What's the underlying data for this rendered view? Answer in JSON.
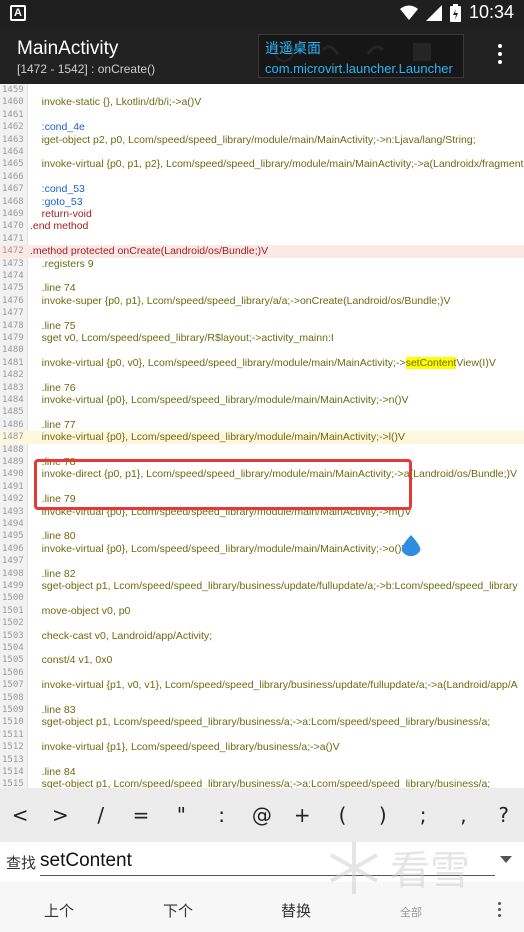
{
  "status": {
    "time": "10:34",
    "left_icon": "A"
  },
  "appbar": {
    "title": "MainActivity",
    "subtitle": "[1472 - 1542] : onCreate()"
  },
  "toast": {
    "title": "逍遥桌面",
    "text": "com.microvirt.launcher.Launcher"
  },
  "code_lines": [
    {
      "n": "1459",
      "t": ""
    },
    {
      "n": "1460",
      "t": "    invoke-static {}, Lkotlin/d/b/i;->a()V"
    },
    {
      "n": "1461",
      "t": ""
    },
    {
      "n": "1462",
      "t": "    :cond_4e",
      "cls": "blue"
    },
    {
      "n": "1463",
      "t": "    iget-object p2, p0, Lcom/speed/speed_library/module/main/MainActivity;->n:Ljava/lang/String;"
    },
    {
      "n": "1464",
      "t": ""
    },
    {
      "n": "1465",
      "t": "    invoke-virtual {p0, p1, p2}, Lcom/speed/speed_library/module/main/MainActivity;->a(Landroidx/fragment"
    },
    {
      "n": "1466",
      "t": ""
    },
    {
      "n": "1467",
      "t": "    :cond_53",
      "cls": "blue"
    },
    {
      "n": "1468",
      "t": "    :goto_53",
      "cls": "blue"
    },
    {
      "n": "1469",
      "t": "    return-void",
      "cls": "kw"
    },
    {
      "n": "1470",
      "t": ".end method",
      "cls": "kw"
    },
    {
      "n": "1471",
      "t": ""
    },
    {
      "n": "1472",
      "t": ".method protected onCreate(Landroid/os/Bundle;)V",
      "cls": "kw",
      "bg": "pink"
    },
    {
      "n": "1473",
      "t": "    .registers 9"
    },
    {
      "n": "1474",
      "t": ""
    },
    {
      "n": "1475",
      "t": "    .line 74"
    },
    {
      "n": "1476",
      "t": "    invoke-super {p0, p1}, Lcom/speed/speed_library/a/a;->onCreate(Landroid/os/Bundle;)V"
    },
    {
      "n": "1477",
      "t": ""
    },
    {
      "n": "1478",
      "t": "    .line 75"
    },
    {
      "n": "1479",
      "t": "    sget v0, Lcom/speed/speed_library/R$layout;->activity_mainn:I"
    },
    {
      "n": "1480",
      "t": ""
    },
    {
      "n": "1481",
      "t": "    invoke-virtual {p0, v0}, Lcom/speed/speed_library/module/main/MainActivity;->",
      "match": "setContent",
      "after": "View(I)V"
    },
    {
      "n": "1482",
      "t": ""
    },
    {
      "n": "1483",
      "t": "    .line 76"
    },
    {
      "n": "1484",
      "t": "    invoke-virtual {p0}, Lcom/speed/speed_library/module/main/MainActivity;->n()V"
    },
    {
      "n": "1485",
      "t": ""
    },
    {
      "n": "1486",
      "t": "    .line 77"
    },
    {
      "n": "1487",
      "t": "    invoke-virtual {p0}, Lcom/speed/speed_library/module/main/MainActivity;->l()V",
      "bg": "yellow"
    },
    {
      "n": "1488",
      "t": ""
    },
    {
      "n": "1489",
      "t": "    .line 78"
    },
    {
      "n": "1490",
      "t": "    invoke-direct {p0, p1}, Lcom/speed/speed_library/module/main/MainActivity;->a(Landroid/os/Bundle;)V"
    },
    {
      "n": "1491",
      "t": ""
    },
    {
      "n": "1492",
      "t": "    .line 79"
    },
    {
      "n": "1493",
      "t": "    invoke-virtual {p0}, Lcom/speed/speed_library/module/main/MainActivity;->m()V"
    },
    {
      "n": "1494",
      "t": ""
    },
    {
      "n": "1495",
      "t": "    .line 80"
    },
    {
      "n": "1496",
      "t": "    invoke-virtual {p0}, Lcom/speed/speed_library/module/main/MainActivity;->o()V"
    },
    {
      "n": "1497",
      "t": ""
    },
    {
      "n": "1498",
      "t": "    .line 82"
    },
    {
      "n": "1499",
      "t": "    sget-object p1, Lcom/speed/speed_library/business/update/fullupdate/a;->b:Lcom/speed/speed_library"
    },
    {
      "n": "1500",
      "t": ""
    },
    {
      "n": "1501",
      "t": "    move-object v0, p0"
    },
    {
      "n": "1502",
      "t": ""
    },
    {
      "n": "1503",
      "t": "    check-cast v0, Landroid/app/Activity;"
    },
    {
      "n": "1504",
      "t": ""
    },
    {
      "n": "1505",
      "t": "    const/4 v1, 0x0"
    },
    {
      "n": "1506",
      "t": ""
    },
    {
      "n": "1507",
      "t": "    invoke-virtual {p1, v0, v1}, Lcom/speed/speed_library/business/update/fullupdate/a;->a(Landroid/app/A"
    },
    {
      "n": "1508",
      "t": ""
    },
    {
      "n": "1509",
      "t": "    .line 83"
    },
    {
      "n": "1510",
      "t": "    sget-object p1, Lcom/speed/speed_library/business/a;->a:Lcom/speed/speed_library/business/a;"
    },
    {
      "n": "1511",
      "t": ""
    },
    {
      "n": "1512",
      "t": "    invoke-virtual {p1}, Lcom/speed/speed_library/business/a;->a()V"
    },
    {
      "n": "1513",
      "t": ""
    },
    {
      "n": "1514",
      "t": "    .line 84"
    },
    {
      "n": "1515",
      "t": "    sget-object p1, Lcom/speed/speed_library/business/a;->a:Lcom/speed/speed_library/business/a;"
    }
  ],
  "symbols": [
    "<",
    ">",
    "/",
    "=",
    "\"",
    ":",
    "@",
    "+",
    "(",
    ")",
    ";",
    ",",
    "?"
  ],
  "search": {
    "label": "查找",
    "value": "setContent"
  },
  "buttons": {
    "prev": "上个",
    "next": "下个",
    "replace": "替换",
    "all": "全部"
  },
  "watermark": {
    "text": "看雪"
  },
  "colors": {
    "highlight_box": "#e53935",
    "toast_text": "#29b6f6",
    "match": "#ffff00"
  }
}
